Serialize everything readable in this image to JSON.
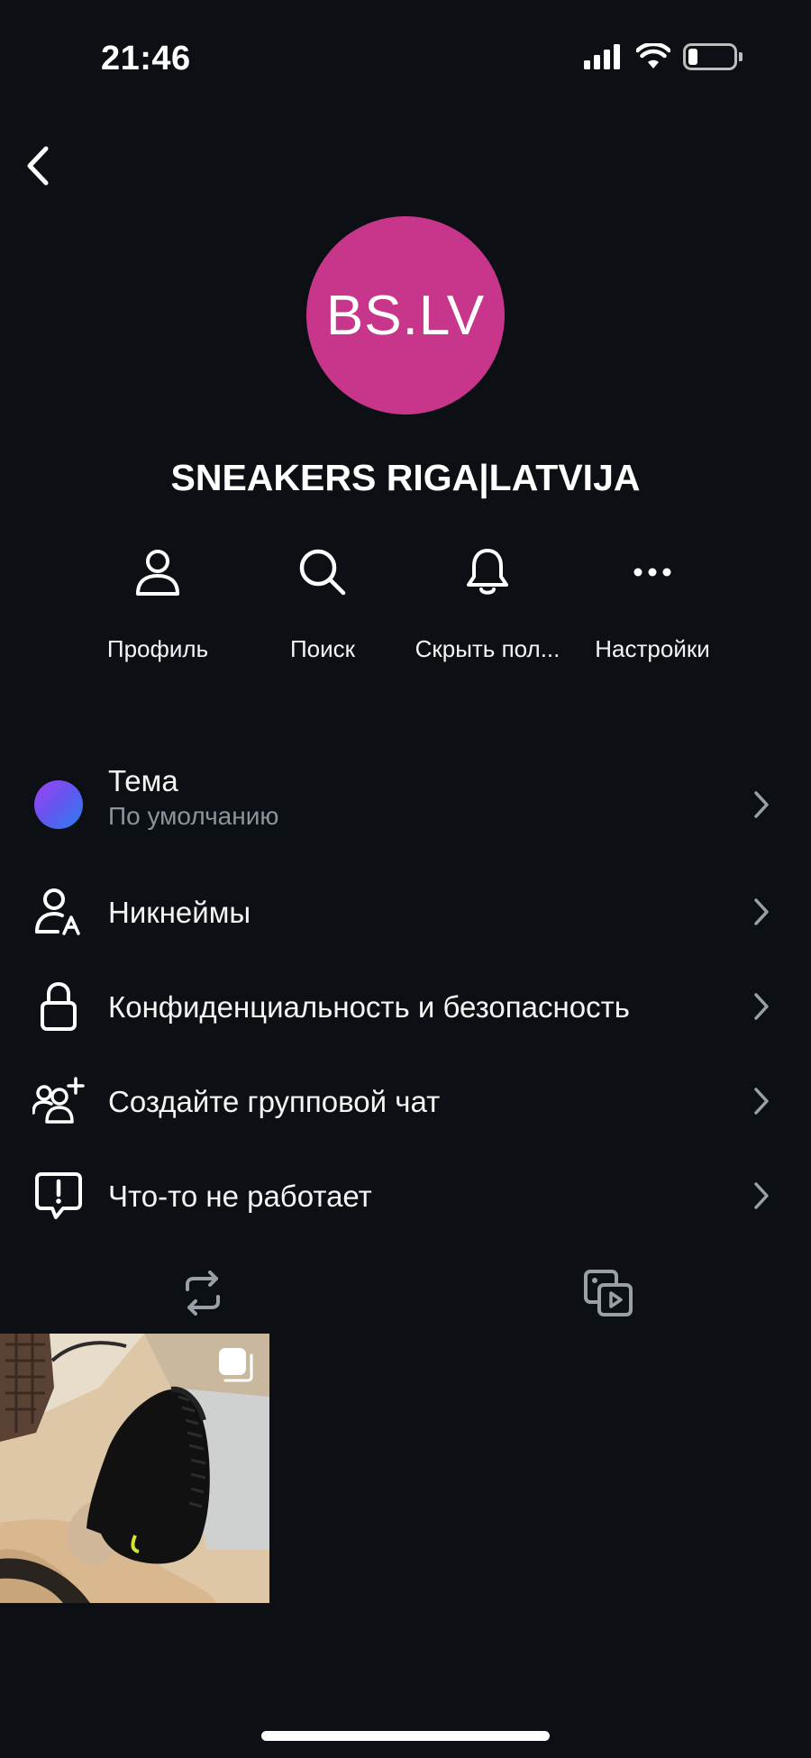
{
  "status_bar": {
    "time": "21:46"
  },
  "profile": {
    "avatar_text": "BS.LV",
    "avatar_color": "#c8368b",
    "name": "SNEAKERS RIGA|LATVIJA"
  },
  "actions": [
    {
      "label": "Профиль",
      "icon": "person-icon"
    },
    {
      "label": "Поиск",
      "icon": "search-icon"
    },
    {
      "label": "Скрыть пол...",
      "icon": "bell-icon"
    },
    {
      "label": "Настройки",
      "icon": "more-dots-icon"
    }
  ],
  "menu": {
    "theme": {
      "title": "Тема",
      "value": "По умолчанию"
    },
    "nicknames": {
      "title": "Никнеймы"
    },
    "privacy": {
      "title": "Конфиденциальность и безопасность"
    },
    "group_chat": {
      "title": "Создайте групповой чат"
    },
    "report": {
      "title": "Что-то не работает"
    }
  },
  "tabs": [
    {
      "icon": "repost-icon"
    },
    {
      "icon": "media-icon"
    }
  ],
  "colors": {
    "background": "#0c1014",
    "text_primary": "#f5f5f5",
    "text_secondary": "#8e949b",
    "accent_gradient": [
      "#a143f5",
      "#2d7ef0"
    ]
  }
}
